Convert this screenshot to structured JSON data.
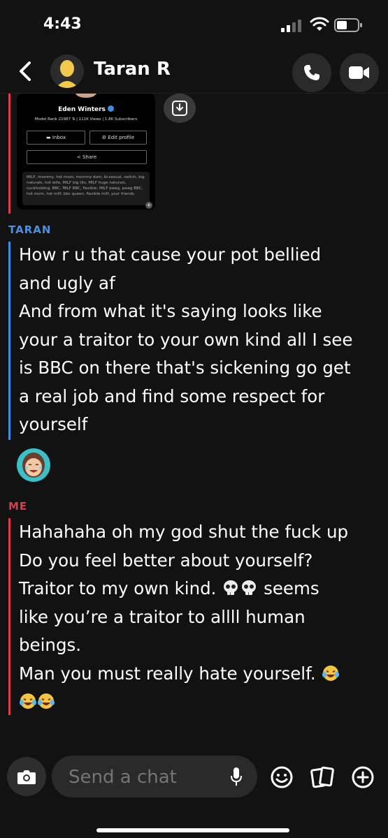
{
  "status_bar": {
    "time": "4:43"
  },
  "header": {
    "contact_name": "Taran R"
  },
  "shared_profile": {
    "name": "Eden Winters",
    "stats": "Model Rank 21987 ⇅ | 111K Views | 1.8K Subscribers",
    "inbox_label": "Inbox",
    "edit_label": "Edit profile",
    "share_label": "Share",
    "bio": "MILF, mommy, hot mom, mommy dom, bi-sexual, switch, big naturals, hot wife, MILF big tits, MILF huge naturals, cuckholding, BBC, MILF BBC, flexible, MILF pawg, pawg BBC, hot mom, hot milf, bbc queen, flexible milf, your friends"
  },
  "messages": [
    {
      "sender": "TARAN",
      "color": "#4a90e2",
      "lines": [
        "How r u that cause your pot bellied",
        "and ugly af",
        "And from what it's saying looks like",
        "your a traitor to your own kind all I see",
        "is BBC on there that's sickening go get",
        "a real job and find some respect for",
        "yourself"
      ]
    },
    {
      "sender": "ME",
      "color": "#e03a4e",
      "lines": [
        "Hahahaha oh my god shut the fuck up",
        "Do you feel better about yourself?",
        "Traitor to my own kind.",
        "seems",
        "like you’re a traitor to allll human",
        "beings.",
        "Man you must really hate yourself."
      ]
    }
  ],
  "composer": {
    "placeholder": "Send a chat"
  },
  "icons": [
    "signal-icon",
    "wifi-icon",
    "battery-icon",
    "back-chevron-icon",
    "phone-icon",
    "video-icon",
    "save-to-chat-icon",
    "camera-icon",
    "microphone-icon",
    "emoji-icon",
    "sticker-icon",
    "plus-icon"
  ]
}
